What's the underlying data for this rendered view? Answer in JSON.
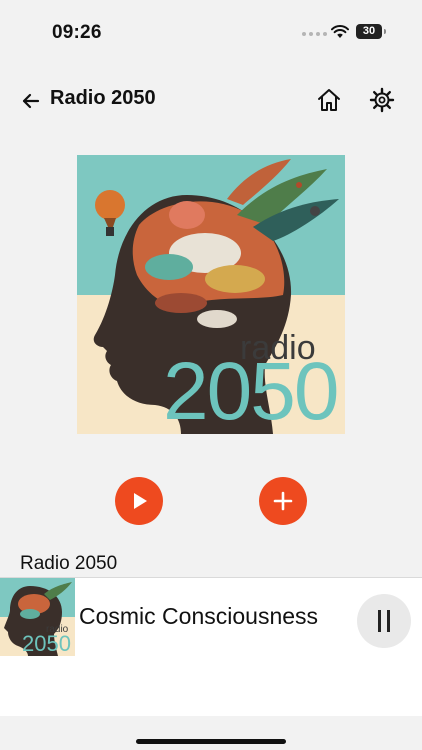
{
  "status_bar": {
    "time": "09:26",
    "battery": "30",
    "icons": [
      "signal-dots-icon",
      "wifi-icon",
      "battery-icon"
    ]
  },
  "header": {
    "title": "Radio 2050",
    "icons": [
      "back-arrow-icon",
      "home-icon",
      "gear-icon"
    ]
  },
  "album_art": {
    "word": "radio",
    "year": "2050",
    "colors": {
      "sky": "#7ec8c1",
      "ground": "#f7e6c6",
      "year_text": "#6dc4bd"
    }
  },
  "actions": {
    "icons": [
      "play-icon",
      "plus-icon"
    ],
    "accent_color": "#ee4a1f"
  },
  "station": {
    "name": "Radio 2050"
  },
  "mini_player": {
    "now_playing": "Cosmic Consciousness",
    "art_word": "radio",
    "art_year": "2050",
    "icons": [
      "pause-icon"
    ]
  }
}
